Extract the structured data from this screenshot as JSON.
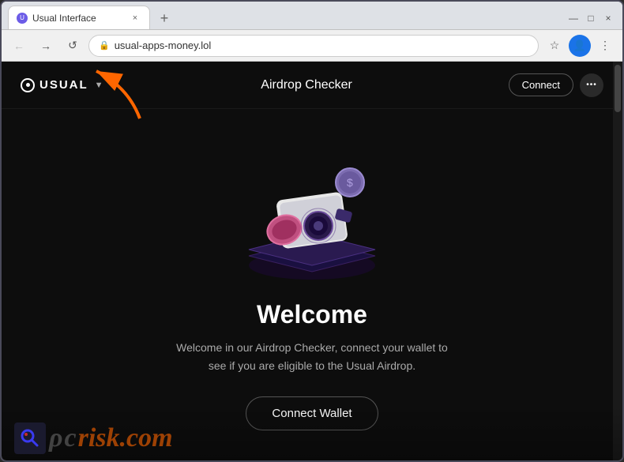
{
  "browser": {
    "tab": {
      "favicon_label": "U",
      "title": "Usual Interface",
      "close_icon": "×",
      "new_tab_icon": "+"
    },
    "window_controls": {
      "minimize": "—",
      "maximize": "□",
      "close": "×"
    },
    "address_bar": {
      "back_icon": "←",
      "forward_icon": "→",
      "reload_icon": "↺",
      "url": "usual-apps-money.lol",
      "lock_icon": "🔒",
      "bookmark_icon": "☆",
      "profile_icon": "👤",
      "more_icon": "⋮"
    }
  },
  "site": {
    "nav": {
      "logo_text": "USUAL",
      "logo_dropdown": "▼",
      "title": "Airdrop Checker",
      "connect_button": "Connect",
      "more_icon": "•••"
    },
    "main": {
      "welcome_title": "Welcome",
      "welcome_desc": "Welcome in our Airdrop Checker, connect your wallet to see if you are eligible to the Usual Airdrop.",
      "connect_wallet_button": "Connect Wallet"
    },
    "watermark": {
      "text_prefix": "pc",
      "text_suffix": "risk.com"
    }
  }
}
